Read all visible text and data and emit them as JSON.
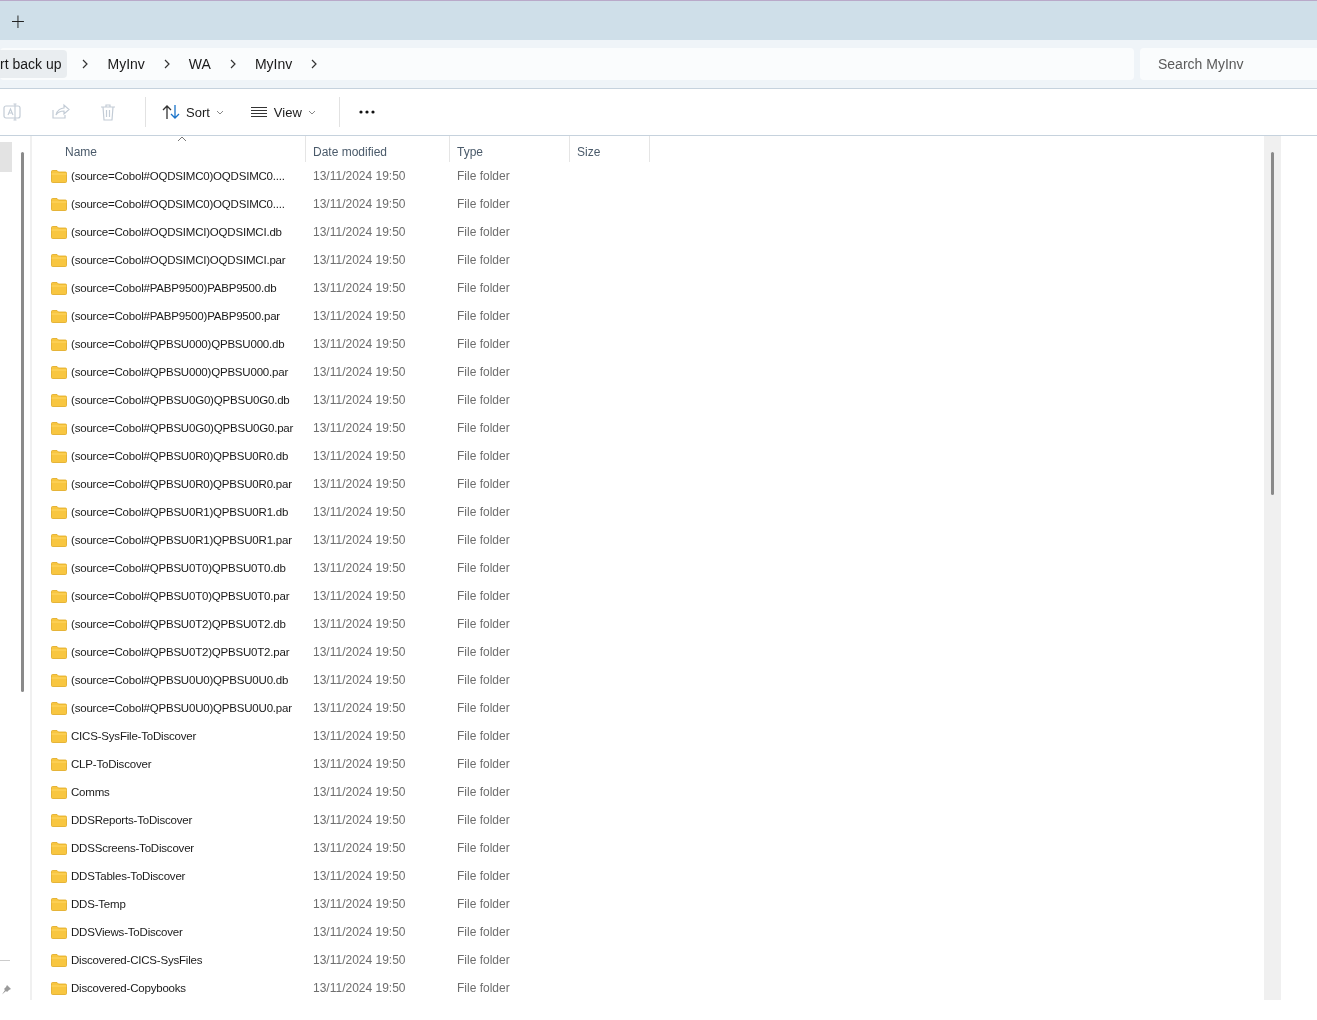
{
  "tab_strip": {
    "new_tab": "+"
  },
  "address_bar": {
    "back_button": "rt back up",
    "crumbs": [
      "MyInv",
      "WA",
      "MyInv"
    ]
  },
  "search": {
    "placeholder": "Search MyInv"
  },
  "toolbar": {
    "actions": [
      {
        "kind": "rename",
        "disabled": true
      },
      {
        "kind": "share",
        "disabled": true
      },
      {
        "kind": "delete",
        "disabled": true
      }
    ],
    "sort": {
      "label": "Sort"
    },
    "view": {
      "label": "View"
    }
  },
  "table": {
    "columns": [
      {
        "label": "Name",
        "sorted": true
      },
      {
        "label": "Date modified",
        "sorted": false
      },
      {
        "label": "Type",
        "sorted": false
      },
      {
        "label": "Size",
        "sorted": false
      }
    ],
    "rows": [
      {
        "name": "(source=Cobol#OQDSIMC0)OQDSIMC0....",
        "date": "13/11/2024 19:50",
        "type": "File folder"
      },
      {
        "name": "(source=Cobol#OQDSIMC0)OQDSIMC0....",
        "date": "13/11/2024 19:50",
        "type": "File folder"
      },
      {
        "name": "(source=Cobol#OQDSIMCI)OQDSIMCI.db",
        "date": "13/11/2024 19:50",
        "type": "File folder"
      },
      {
        "name": "(source=Cobol#OQDSIMCI)OQDSIMCI.par",
        "date": "13/11/2024 19:50",
        "type": "File folder"
      },
      {
        "name": "(source=Cobol#PABP9500)PABP9500.db",
        "date": "13/11/2024 19:50",
        "type": "File folder"
      },
      {
        "name": "(source=Cobol#PABP9500)PABP9500.par",
        "date": "13/11/2024 19:50",
        "type": "File folder"
      },
      {
        "name": "(source=Cobol#QPBSU000)QPBSU000.db",
        "date": "13/11/2024 19:50",
        "type": "File folder"
      },
      {
        "name": "(source=Cobol#QPBSU000)QPBSU000.par",
        "date": "13/11/2024 19:50",
        "type": "File folder"
      },
      {
        "name": "(source=Cobol#QPBSU0G0)QPBSU0G0.db",
        "date": "13/11/2024 19:50",
        "type": "File folder"
      },
      {
        "name": "(source=Cobol#QPBSU0G0)QPBSU0G0.par",
        "date": "13/11/2024 19:50",
        "type": "File folder"
      },
      {
        "name": "(source=Cobol#QPBSU0R0)QPBSU0R0.db",
        "date": "13/11/2024 19:50",
        "type": "File folder"
      },
      {
        "name": "(source=Cobol#QPBSU0R0)QPBSU0R0.par",
        "date": "13/11/2024 19:50",
        "type": "File folder"
      },
      {
        "name": "(source=Cobol#QPBSU0R1)QPBSU0R1.db",
        "date": "13/11/2024 19:50",
        "type": "File folder"
      },
      {
        "name": "(source=Cobol#QPBSU0R1)QPBSU0R1.par",
        "date": "13/11/2024 19:50",
        "type": "File folder"
      },
      {
        "name": "(source=Cobol#QPBSU0T0)QPBSU0T0.db",
        "date": "13/11/2024 19:50",
        "type": "File folder"
      },
      {
        "name": "(source=Cobol#QPBSU0T0)QPBSU0T0.par",
        "date": "13/11/2024 19:50",
        "type": "File folder"
      },
      {
        "name": "(source=Cobol#QPBSU0T2)QPBSU0T2.db",
        "date": "13/11/2024 19:50",
        "type": "File folder"
      },
      {
        "name": "(source=Cobol#QPBSU0T2)QPBSU0T2.par",
        "date": "13/11/2024 19:50",
        "type": "File folder"
      },
      {
        "name": "(source=Cobol#QPBSU0U0)QPBSU0U0.db",
        "date": "13/11/2024 19:50",
        "type": "File folder"
      },
      {
        "name": "(source=Cobol#QPBSU0U0)QPBSU0U0.par",
        "date": "13/11/2024 19:50",
        "type": "File folder"
      },
      {
        "name": "CICS-SysFile-ToDiscover",
        "date": "13/11/2024 19:50",
        "type": "File folder"
      },
      {
        "name": "CLP-ToDiscover",
        "date": "13/11/2024 19:50",
        "type": "File folder"
      },
      {
        "name": "Comms",
        "date": "13/11/2024 19:50",
        "type": "File folder"
      },
      {
        "name": "DDSReports-ToDiscover",
        "date": "13/11/2024 19:50",
        "type": "File folder"
      },
      {
        "name": "DDSScreens-ToDiscover",
        "date": "13/11/2024 19:50",
        "type": "File folder"
      },
      {
        "name": "DDSTables-ToDiscover",
        "date": "13/11/2024 19:50",
        "type": "File folder"
      },
      {
        "name": "DDS-Temp",
        "date": "13/11/2024 19:50",
        "type": "File folder"
      },
      {
        "name": "DDSViews-ToDiscover",
        "date": "13/11/2024 19:50",
        "type": "File folder"
      },
      {
        "name": "Discovered-CICS-SysFiles",
        "date": "13/11/2024 19:50",
        "type": "File folder"
      },
      {
        "name": "Discovered-Copybooks",
        "date": "13/11/2024 19:50",
        "type": "File folder"
      }
    ]
  }
}
